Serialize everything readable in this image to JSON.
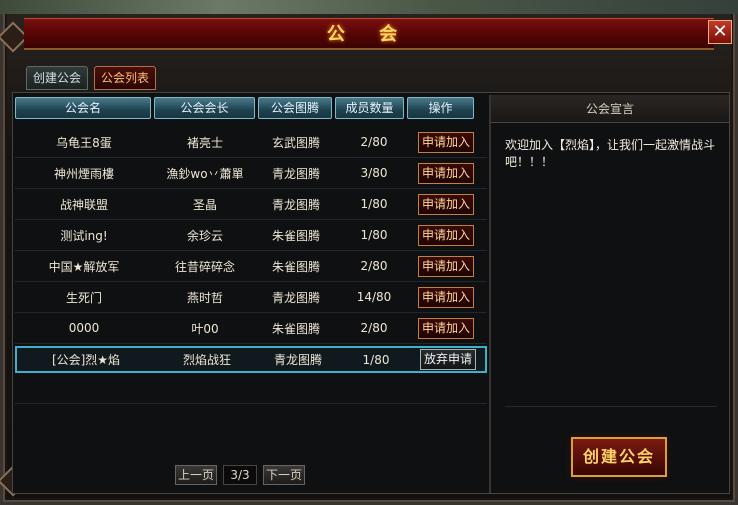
{
  "window": {
    "title": "公 会",
    "close_label": "✕"
  },
  "tabs": [
    {
      "label": "创建公会",
      "active": false
    },
    {
      "label": "公会列表",
      "active": true
    }
  ],
  "columns": [
    "公会名",
    "公会会长",
    "公会图腾",
    "成员数量",
    "操作"
  ],
  "rows": [
    {
      "name": "乌龟王8蛋",
      "leader": "褚亮士",
      "totem": "玄武图腾",
      "members": "2/80",
      "action": "申请加入"
    },
    {
      "name": "神州煙雨樓",
      "leader": "漁鈔wo丷蕭單",
      "totem": "青龙图腾",
      "members": "3/80",
      "action": "申请加入"
    },
    {
      "name": "战神联盟",
      "leader": "圣晶",
      "totem": "青龙图腾",
      "members": "1/80",
      "action": "申请加入"
    },
    {
      "name": "测试ing!",
      "leader": "余珍云",
      "totem": "朱雀图腾",
      "members": "1/80",
      "action": "申请加入"
    },
    {
      "name": "中国★解放军",
      "leader": "往昔碎碎念",
      "totem": "朱雀图腾",
      "members": "2/80",
      "action": "申请加入"
    },
    {
      "name": "生死门",
      "leader": "燕时哲",
      "totem": "青龙图腾",
      "members": "14/80",
      "action": "申请加入"
    },
    {
      "name": "0000",
      "leader": "叶00",
      "totem": "朱雀图腾",
      "members": "2/80",
      "action": "申请加入"
    },
    {
      "name": "[公会]烈★焰",
      "leader": "烈焰战狂",
      "totem": "青龙图腾",
      "members": "1/80",
      "action": "放弃申请"
    }
  ],
  "pager": {
    "prev": "上一页",
    "page": "3/3",
    "next": "下一页"
  },
  "declaration": {
    "title": "公会宣言",
    "text": "欢迎加入【烈焰】，让我们一起激情战斗吧！！！"
  },
  "create_button": "创建公会"
}
